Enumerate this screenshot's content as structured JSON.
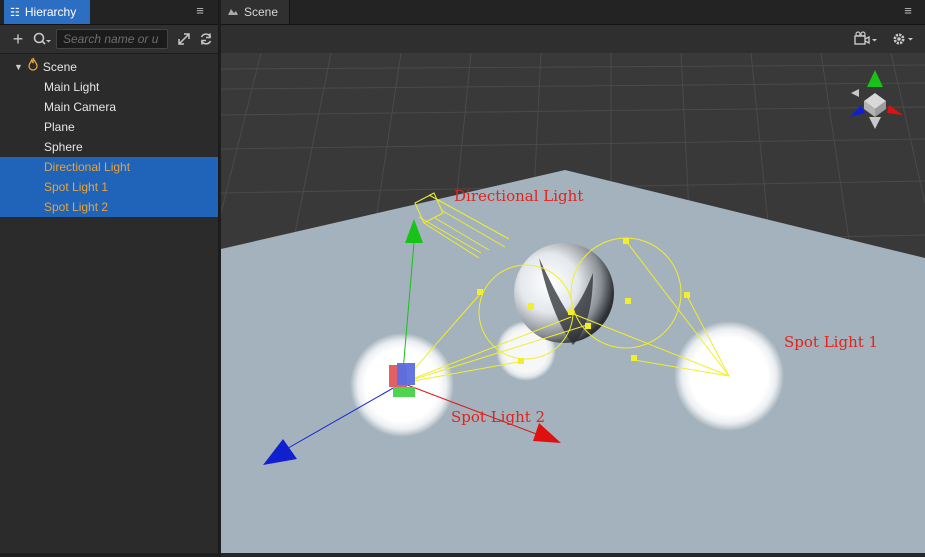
{
  "hierarchy": {
    "tab_label": "Hierarchy",
    "search_placeholder": "Search name or u",
    "items": [
      {
        "label": "Scene"
      },
      {
        "label": "Main Light"
      },
      {
        "label": "Main Camera"
      },
      {
        "label": "Plane"
      },
      {
        "label": "Sphere"
      },
      {
        "label": "Directional Light"
      },
      {
        "label": "Spot Light 1"
      },
      {
        "label": "Spot Light 2"
      }
    ],
    "selected": [
      "Directional Light",
      "Spot Light 1",
      "Spot Light 2"
    ]
  },
  "scene": {
    "tab_label": "Scene",
    "labels": {
      "directional": "Directional Light",
      "spot1": "Spot Light 1",
      "spot2": "Spot Light 2"
    }
  },
  "colors": {
    "selection": "#1f64b8",
    "selected_text": "#e8a33a",
    "tab_active": "#2c6fc2",
    "gizmo_x": "#e01010",
    "gizmo_y": "#19c219",
    "gizmo_z": "#1020d0",
    "light_gizmo": "#f2ee2a",
    "label_red": "#e0241e"
  },
  "icons": [
    "hierarchy-icon",
    "menu-icon",
    "add-icon",
    "search-icon",
    "expand-icon",
    "refresh-icon",
    "scene-icon",
    "camera-icon",
    "settings-icon",
    "view-gizmo-icon"
  ]
}
